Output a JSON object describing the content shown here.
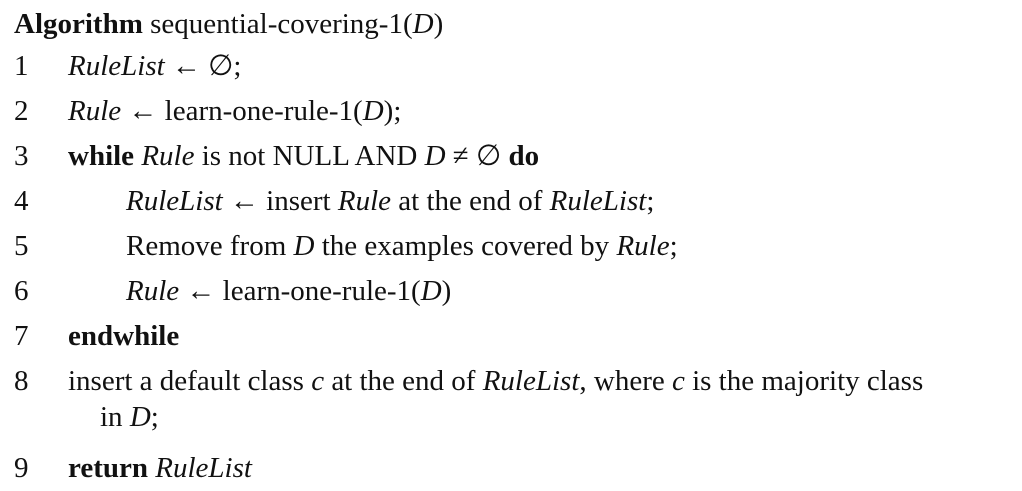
{
  "algorithm": {
    "keyword": "Algorithm",
    "name": "sequential-covering-1(",
    "param": "D",
    "name_close": ")"
  },
  "lines": {
    "1": {
      "num": "1",
      "a": "RuleList",
      "b": " ← ∅;"
    },
    "2": {
      "num": "2",
      "a": "Rule",
      "b": " ← learn-one-rule-1(",
      "c": "D",
      "d": ");"
    },
    "3": {
      "num": "3",
      "kw1": "while",
      "a": "Rule",
      "b": " is not NULL AND ",
      "c": "D",
      "d": " ≠ ∅ ",
      "kw2": "do"
    },
    "4": {
      "num": "4",
      "a": "RuleList",
      "b": " ← insert ",
      "c": "Rule",
      "d": " at the end of ",
      "e": "RuleList",
      "f": ";"
    },
    "5": {
      "num": "5",
      "a": "Remove from ",
      "b": "D",
      "c": " the examples covered by ",
      "d": "Rule",
      "e": ";"
    },
    "6": {
      "num": "6",
      "a": "Rule",
      "b": " ← learn-one-rule-1(",
      "c": "D",
      "d": ")"
    },
    "7": {
      "num": "7",
      "kw1": "endwhile"
    },
    "8": {
      "num": "8",
      "a": "insert a default class ",
      "b": "c",
      "c": " at the end of ",
      "d": "RuleList",
      "e": ", where ",
      "f": "c",
      "g": " is the majority class",
      "h": "in ",
      "i": "D",
      "j": ";"
    },
    "9": {
      "num": "9",
      "kw1": "return",
      "a": "RuleList"
    }
  }
}
